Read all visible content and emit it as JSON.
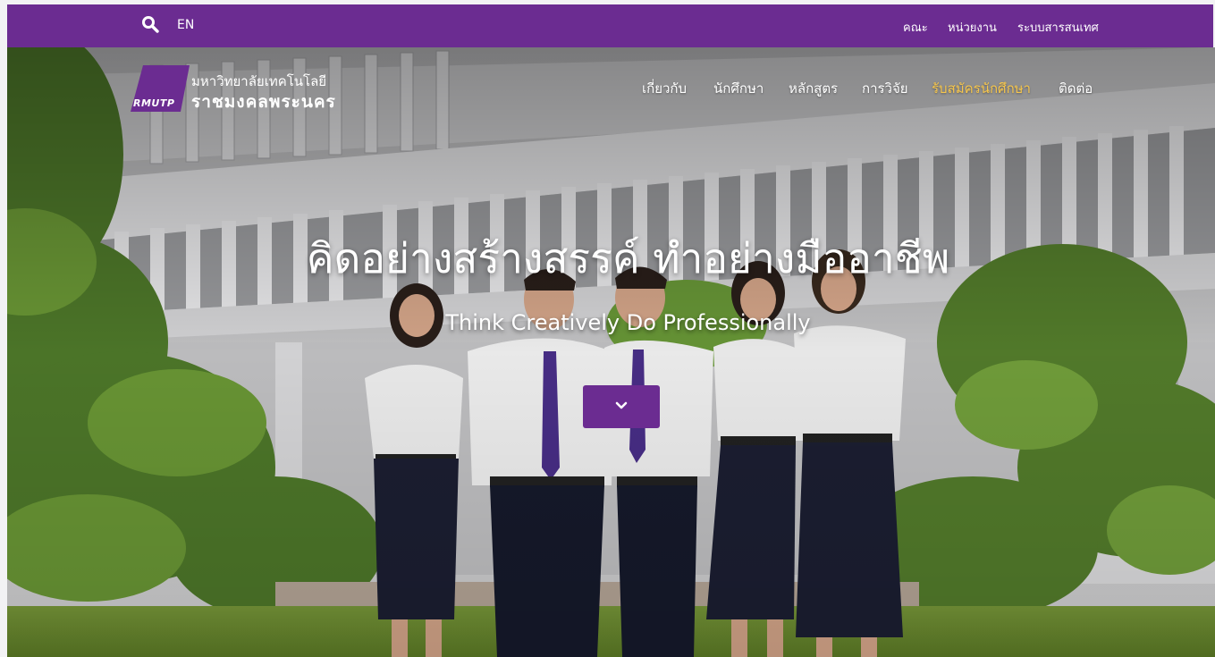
{
  "topbar": {
    "lang_label": "EN",
    "links": [
      "คณะ",
      "หน่วยงาน",
      "ระบบสารสนเทศ"
    ],
    "background_color": "#6b2c91"
  },
  "logo": {
    "abbr": "RMUTP",
    "name_line1": "มหาวิทยาลัยเทคโนโลยี",
    "name_line2": "ราชมงคลพระนคร"
  },
  "nav": {
    "items": [
      {
        "label": "เกี่ยวกับ"
      },
      {
        "label": "นักศึกษา"
      },
      {
        "label": "หลักสูตร"
      },
      {
        "label": "การวิจัย"
      },
      {
        "label": "รับสมัครนักศึกษา",
        "active": true
      },
      {
        "label": "ติดต่อ"
      }
    ],
    "active_color": "#f6c64d"
  },
  "hero": {
    "headline": "คิดอย่างสร้างสรรค์ ทำอย่างมืออาชีพ",
    "subheadline": "Think Creatively Do Professionally",
    "scroll_icon": "chevron-down-icon"
  }
}
